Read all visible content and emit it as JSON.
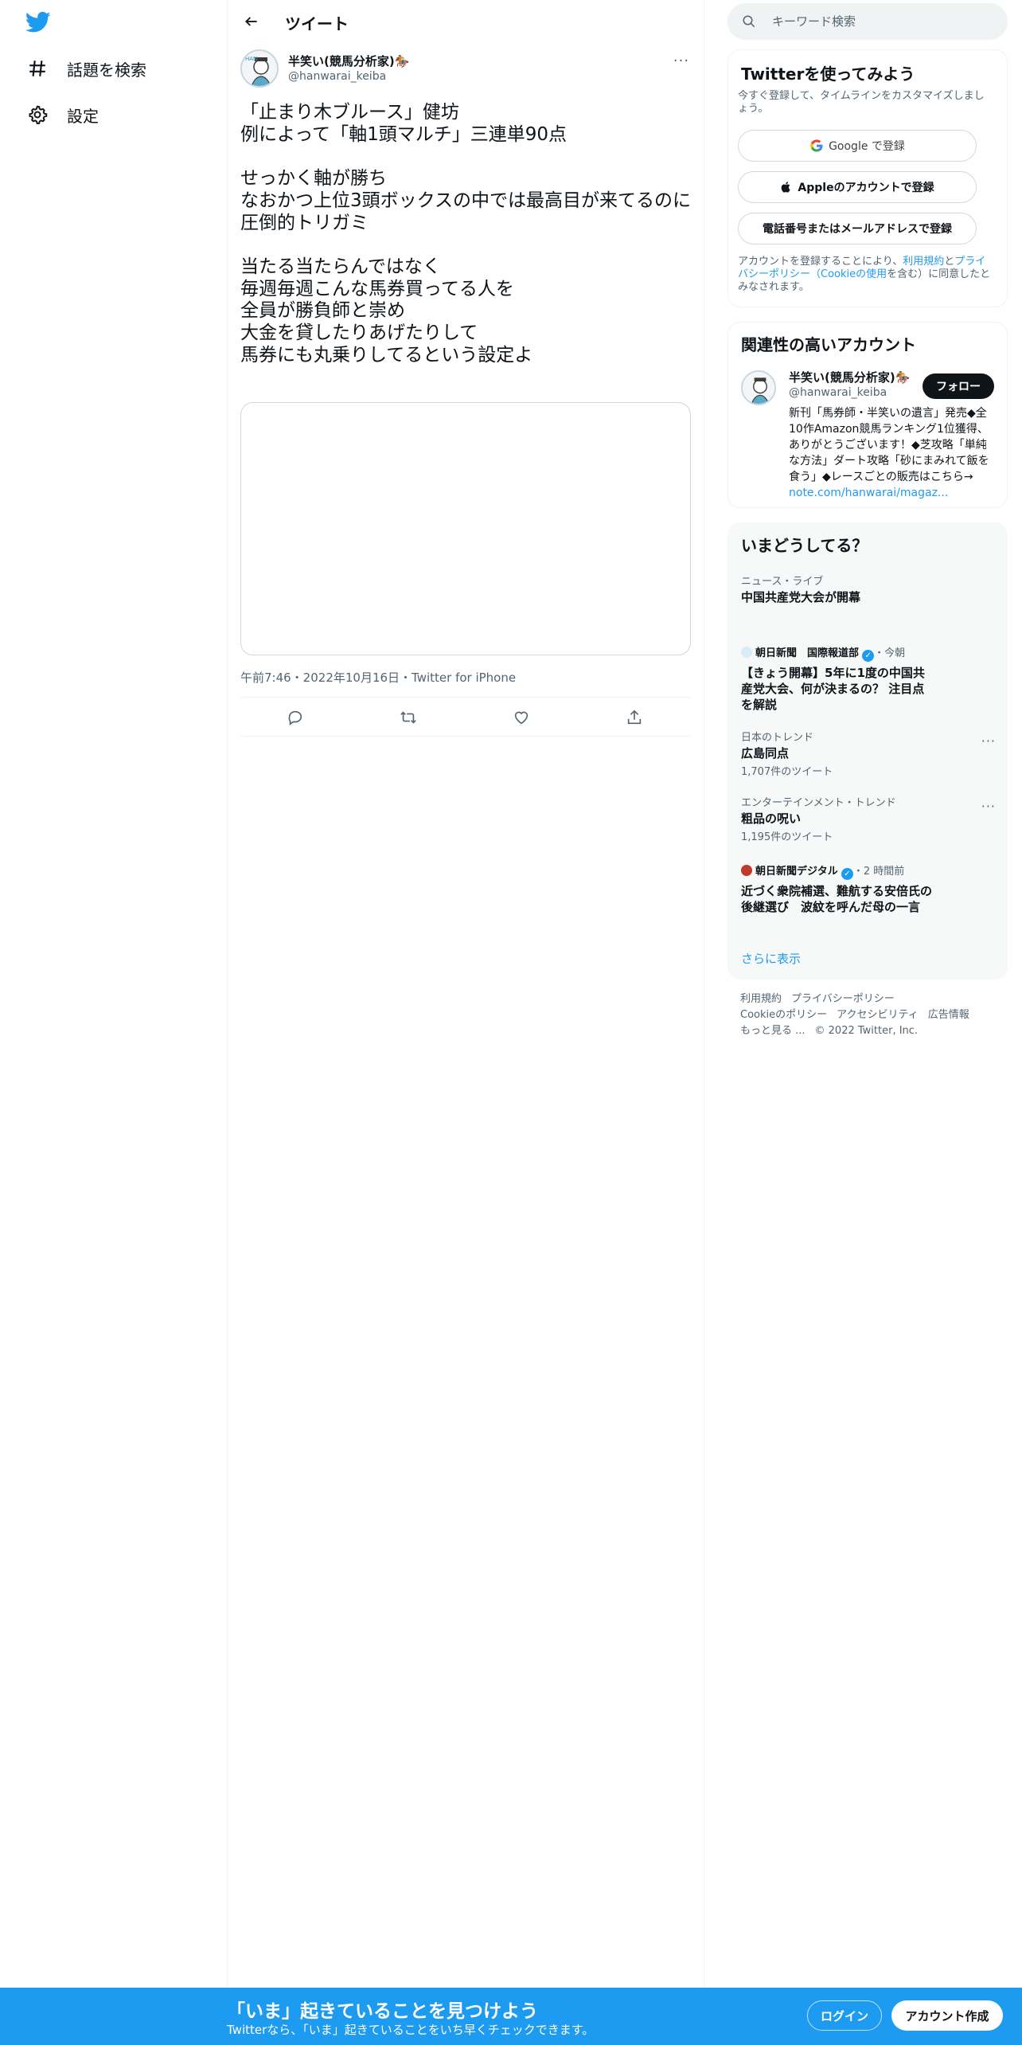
{
  "nav": {
    "explore_label": "話題を検索",
    "settings_label": "設定"
  },
  "header": {
    "title": "ツイート"
  },
  "tweet": {
    "author_name": "半笑い(競馬分析家)🏇",
    "author_handle": "@hanwarai_keiba",
    "text": "「止まり木ブルース」健坊\n例によって「軸1頭マルチ」三連単90点\n\nせっかく軸が勝ち\nなおかつ上位3頭ボックスの中では最高目が来てるのに\n圧倒的トリガミ\n\n当たる当たらんではなく\n毎週毎週こんな馬券買ってる人を\n全員が勝負師と崇め\n大金を貸したりあげたりして\n馬券にも丸乗りしてるという設定よ",
    "meta": "午前7:46・2022年10月16日・Twitter for iPhone"
  },
  "search": {
    "placeholder": "キーワード検索"
  },
  "signup_box": {
    "title": "Twitterを使ってみよう",
    "subtitle": "今すぐ登録して、タイムラインをカスタマイズしましょう。",
    "google_label": "Google で登録",
    "apple_label": "Appleのアカウントで登録",
    "phone_label": "電話番号またはメールアドレスで登録",
    "terms_prefix": "アカウントを登録することにより、",
    "terms_link": "利用規約",
    "terms_and": "と",
    "privacy_link": "プライバシーポリシー（Cookieの使用",
    "terms_suffix": "を含む）に同意したとみなされます。"
  },
  "related": {
    "title": "関連性の高いアカウント",
    "name": "半笑い(競馬分析家)🏇",
    "handle": "@hanwarai_keiba",
    "follow_label": "フォロー",
    "bio": "新刊「馬券師・半笑いの遺言」発売◆全10作Amazon競馬ランキング1位獲得、ありがとうございます！◆芝攻略「単純な方法」ダート攻略「砂にまみれて飯を食う」◆レースごとの販売はこちら→ ",
    "bio_link": "note.com/hanwarai/magaz..."
  },
  "trends": {
    "title": "いまどうしてる？",
    "items": [
      {
        "category": "ニュース・ライブ",
        "title": "中国共産党大会が開幕"
      },
      {
        "source": "朝日新聞　国際報道部",
        "time": "・今朝",
        "title": "【きょう開幕】5年に1度の中国共産党大会、何が決まるの？ 注目点を解説"
      },
      {
        "category": "日本のトレンド",
        "title": "広島同点",
        "count": "1,707件のツイート"
      },
      {
        "category": "エンターテインメント・トレンド",
        "title": "粗品の呪い",
        "count": "1,195件のツイート"
      },
      {
        "source": "朝日新聞デジタル",
        "time": "・2 時間前",
        "title": "近づく衆院補選、難航する安倍氏の後継選び　波紋を呼んだ母の一言"
      }
    ],
    "show_more": "さらに表示"
  },
  "footer": {
    "terms": "利用規約",
    "privacy": "プライバシーポリシー",
    "cookie": "Cookieのポリシー",
    "accessibility": "アクセシビリティ",
    "ads": "広告情報",
    "more": "もっと見る ...",
    "copyright": "© 2022 Twitter, Inc."
  },
  "bottombar": {
    "title": "「いま」起きていることを見つけよう",
    "subtitle": "Twitterなら、「いま」起きていることをいち早くチェックできます。",
    "login": "ログイン",
    "signup": "アカウント作成"
  },
  "colors": {
    "accent": "#1d9bf0",
    "text": "#0f1419",
    "secondary": "#536471"
  }
}
